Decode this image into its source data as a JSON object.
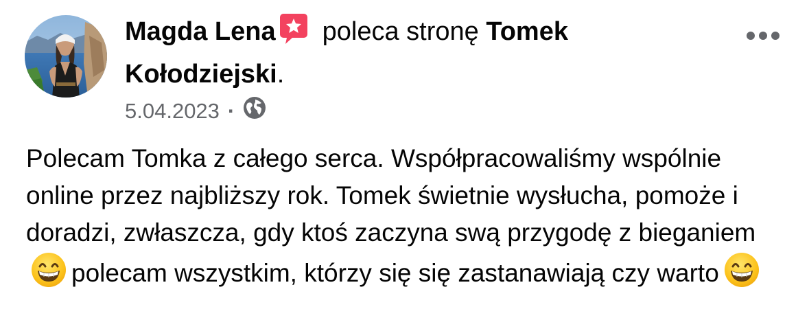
{
  "post": {
    "author": "Magda Lena",
    "verb": "poleca stronę",
    "page_name_line1": "Tomek",
    "page_name_line2": "Kołodziejski",
    "period": ".",
    "date": "5.04.2023",
    "separator": "·",
    "privacy_icon": "globe-icon",
    "recommend_badge_icon": "recommend-star-icon",
    "more_icon": "more-dots-icon",
    "body": {
      "part1": "Polecam Tomka z całego serca. Współpracowaliśmy wspólnie online przez najbliższy rok. Tomek świetnie wysłucha, pomoże i doradzi, zwłaszcza, gdy ktoś zaczyna swą przygodę z bieganiem",
      "part2": "polecam wszystkim, którzy się się zastanawiają czy warto",
      "emoji_icon": "grinning-face-icon"
    }
  },
  "colors": {
    "text": "#050505",
    "secondary_text": "#65676b",
    "badge": "#f3425f"
  }
}
